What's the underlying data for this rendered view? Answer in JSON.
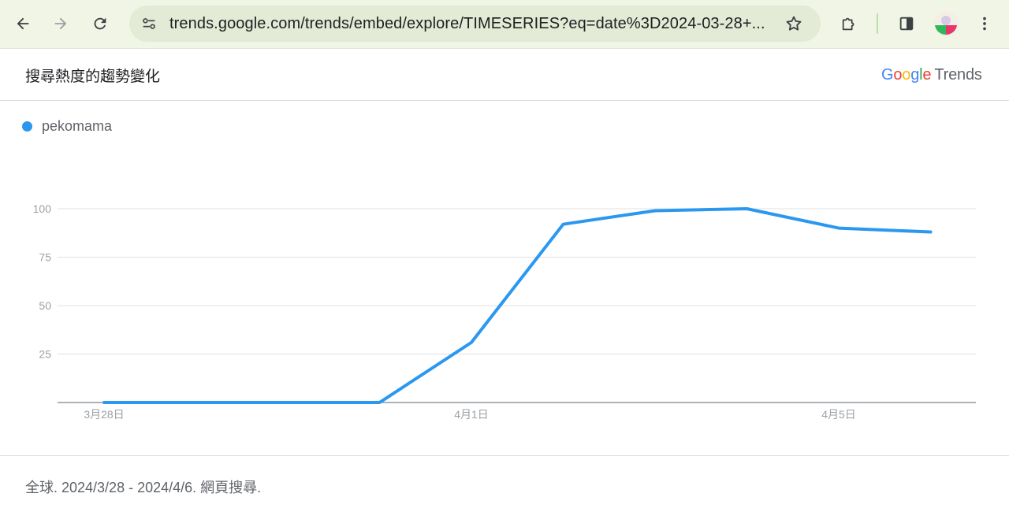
{
  "browser": {
    "url": "trends.google.com/trends/embed/explore/TIMESERIES?eq=date%3D2024-03-28+..."
  },
  "header": {
    "title": "搜尋熱度的趨勢變化",
    "brand_google": "Google",
    "brand_trends": "Trends"
  },
  "legend": {
    "label": "pekomama",
    "color": "#2b98f0"
  },
  "chart_data": {
    "type": "line",
    "x": [
      "3月28日",
      "3月29日",
      "3月30日",
      "3月31日",
      "4月1日",
      "4月2日",
      "4月3日",
      "4月4日",
      "4月5日",
      "4月6日"
    ],
    "series": [
      {
        "name": "pekomama",
        "values": [
          0,
          0,
          0,
          0,
          31,
          92,
          99,
          100,
          90,
          88
        ],
        "color": "#2b98f0"
      }
    ],
    "x_tick_labels": [
      "3月28日",
      "4月1日",
      "4月5日"
    ],
    "y_ticks": [
      25,
      50,
      75,
      100
    ],
    "ylim": [
      0,
      100
    ],
    "grid": true
  },
  "footer": {
    "text": "全球. 2024/3/28 - 2024/4/6. 網頁搜尋."
  }
}
